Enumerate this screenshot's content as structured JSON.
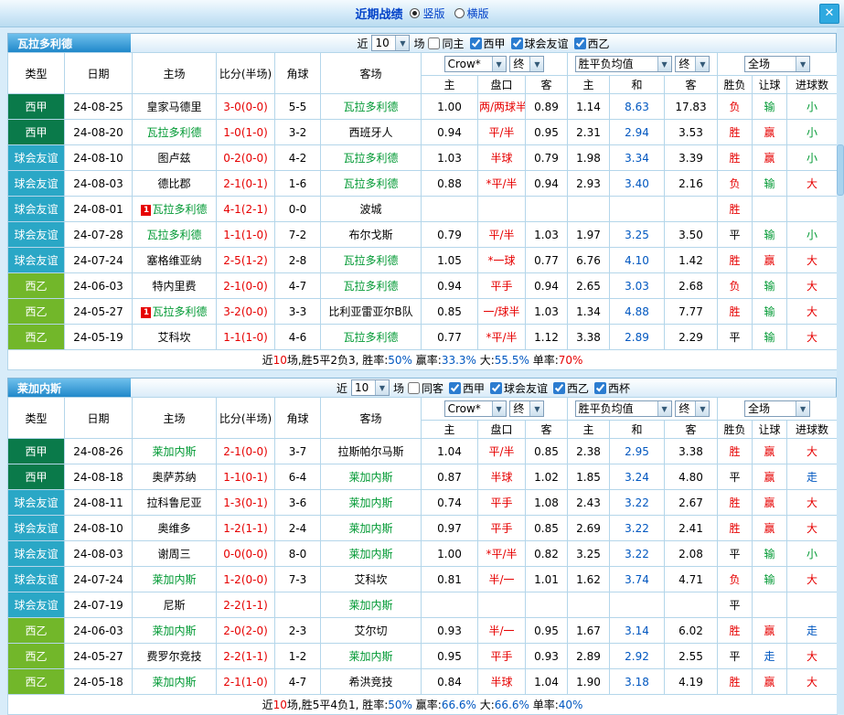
{
  "topbar": {
    "title": "近期战绩",
    "radios": [
      {
        "label": "竖版",
        "selected": true
      },
      {
        "label": "横版",
        "selected": false
      }
    ],
    "close_icon": "✕"
  },
  "table_headers": {
    "left": [
      "类型",
      "日期",
      "主场",
      "比分(半场)",
      "角球",
      "客场"
    ],
    "sub": [
      "主",
      "盘口",
      "客",
      "主",
      "和",
      "客",
      "胜负",
      "让球",
      "进球数"
    ]
  },
  "colors": {
    "accent_blue": "#0141c8",
    "value_blue": "#0057c0",
    "focal_green": "#009933",
    "score_red": "#e60000",
    "league_liga": "#0a7a4a",
    "league_friendly": "#2aa7c6",
    "league_segunda": "#72b72a"
  },
  "sections": [
    {
      "team": "瓦拉多利德",
      "filters": {
        "near": "近",
        "count": "10",
        "suffix": "场",
        "checkboxes": [
          {
            "label": "同主",
            "checked": false
          },
          {
            "label": "西甲",
            "checked": true
          },
          {
            "label": "球会友谊",
            "checked": true
          },
          {
            "label": "西乙",
            "checked": true
          }
        ]
      },
      "selects": {
        "company": "Crow*",
        "company_time": "终",
        "avg": "胜平负均值",
        "avg_time": "终",
        "scope": "全场"
      },
      "rows": [
        {
          "lg": "西甲",
          "lgc": "liga",
          "date": "24-08-25",
          "home": "皇家马德里",
          "hf": false,
          "hb": "",
          "score": "3-0(0-0)",
          "corner": "5-5",
          "away": "瓦拉多利德",
          "af": true,
          "ab": "",
          "oh": "1.00",
          "hc": "两/两球半",
          "oa": "0.89",
          "ah": "1.14",
          "ad": "8.63",
          "aa": "17.83",
          "res": "负",
          "resc": "red",
          "cov": "输",
          "covc": "green",
          "gl": "小",
          "glc": "green"
        },
        {
          "lg": "西甲",
          "lgc": "liga",
          "date": "24-08-20",
          "home": "瓦拉多利德",
          "hf": true,
          "hb": "",
          "score": "1-0(1-0)",
          "corner": "3-2",
          "away": "西班牙人",
          "af": false,
          "ab": "",
          "oh": "0.94",
          "hc": "平/半",
          "oa": "0.95",
          "ah": "2.31",
          "ad": "2.94",
          "aa": "3.53",
          "res": "胜",
          "resc": "red",
          "cov": "赢",
          "covc": "red",
          "gl": "小",
          "glc": "green"
        },
        {
          "lg": "球会友谊",
          "lgc": "friendly",
          "date": "24-08-10",
          "home": "图卢兹",
          "hf": false,
          "hb": "",
          "score": "0-2(0-0)",
          "corner": "4-2",
          "away": "瓦拉多利德",
          "af": true,
          "ab": "",
          "oh": "1.03",
          "hc": "半球",
          "oa": "0.79",
          "ah": "1.98",
          "ad": "3.34",
          "aa": "3.39",
          "res": "胜",
          "resc": "red",
          "cov": "赢",
          "covc": "red",
          "gl": "小",
          "glc": "green"
        },
        {
          "lg": "球会友谊",
          "lgc": "friendly",
          "date": "24-08-03",
          "home": "德比郡",
          "hf": false,
          "hb": "",
          "score": "2-1(0-1)",
          "corner": "1-6",
          "away": "瓦拉多利德",
          "af": true,
          "ab": "",
          "oh": "0.88",
          "hc": "*平/半",
          "oa": "0.94",
          "ah": "2.93",
          "ad": "3.40",
          "aa": "2.16",
          "res": "负",
          "resc": "red",
          "cov": "输",
          "covc": "green",
          "gl": "大",
          "glc": "red"
        },
        {
          "lg": "球会友谊",
          "lgc": "friendly",
          "date": "24-08-01",
          "home": "瓦拉多利德",
          "hf": true,
          "hb": "1",
          "score": "4-1(2-1)",
          "corner": "0-0",
          "away": "波城",
          "af": false,
          "ab": "",
          "oh": "",
          "hc": "",
          "oa": "",
          "ah": "",
          "ad": "",
          "aa": "",
          "res": "胜",
          "resc": "red",
          "cov": "",
          "covc": "",
          "gl": "",
          "glc": ""
        },
        {
          "lg": "球会友谊",
          "lgc": "friendly",
          "date": "24-07-28",
          "home": "瓦拉多利德",
          "hf": true,
          "hb": "",
          "score": "1-1(1-0)",
          "corner": "7-2",
          "away": "布尔戈斯",
          "af": false,
          "ab": "",
          "oh": "0.79",
          "hc": "平/半",
          "oa": "1.03",
          "ah": "1.97",
          "ad": "3.25",
          "aa": "3.50",
          "res": "平",
          "resc": "black",
          "cov": "输",
          "covc": "green",
          "gl": "小",
          "glc": "green"
        },
        {
          "lg": "球会友谊",
          "lgc": "friendly",
          "date": "24-07-24",
          "home": "塞格维亚纳",
          "hf": false,
          "hb": "",
          "score": "2-5(1-2)",
          "corner": "2-8",
          "away": "瓦拉多利德",
          "af": true,
          "ab": "",
          "oh": "1.05",
          "hc": "*一球",
          "oa": "0.77",
          "ah": "6.76",
          "ad": "4.10",
          "aa": "1.42",
          "res": "胜",
          "resc": "red",
          "cov": "赢",
          "covc": "red",
          "gl": "大",
          "glc": "red"
        },
        {
          "lg": "西乙",
          "lgc": "segunda",
          "date": "24-06-03",
          "home": "特内里费",
          "hf": false,
          "hb": "",
          "score": "2-1(0-0)",
          "corner": "4-7",
          "away": "瓦拉多利德",
          "af": true,
          "ab": "",
          "oh": "0.94",
          "hc": "平手",
          "oa": "0.94",
          "ah": "2.65",
          "ad": "3.03",
          "aa": "2.68",
          "res": "负",
          "resc": "red",
          "cov": "输",
          "covc": "green",
          "gl": "大",
          "glc": "red"
        },
        {
          "lg": "西乙",
          "lgc": "segunda",
          "date": "24-05-27",
          "home": "瓦拉多利德",
          "hf": true,
          "hb": "1",
          "score": "3-2(0-0)",
          "corner": "3-3",
          "away": "比利亚雷亚尔B队",
          "af": false,
          "ab": "",
          "oh": "0.85",
          "hc": "一/球半",
          "oa": "1.03",
          "ah": "1.34",
          "ad": "4.88",
          "aa": "7.77",
          "res": "胜",
          "resc": "red",
          "cov": "输",
          "covc": "green",
          "gl": "大",
          "glc": "red"
        },
        {
          "lg": "西乙",
          "lgc": "segunda",
          "date": "24-05-19",
          "home": "艾科坎",
          "hf": false,
          "hb": "",
          "score": "1-1(1-0)",
          "corner": "4-6",
          "away": "瓦拉多利德",
          "af": true,
          "ab": "",
          "oh": "0.77",
          "hc": "*平/半",
          "oa": "1.12",
          "ah": "3.38",
          "ad": "2.89",
          "aa": "2.29",
          "res": "平",
          "resc": "black",
          "cov": "输",
          "covc": "green",
          "gl": "大",
          "glc": "red"
        }
      ],
      "summary": [
        {
          "t": "近"
        },
        {
          "t": "10",
          "c": "red"
        },
        {
          "t": "场,胜5平2负3, 胜率:"
        },
        {
          "t": "50%",
          "c": "blue"
        },
        {
          "t": " 赢率:"
        },
        {
          "t": "33.3%",
          "c": "blue"
        },
        {
          "t": " 大:"
        },
        {
          "t": "55.5%",
          "c": "blue"
        },
        {
          "t": " 单率:"
        },
        {
          "t": "70%",
          "c": "red"
        }
      ]
    },
    {
      "team": "莱加内斯",
      "filters": {
        "near": "近",
        "count": "10",
        "suffix": "场",
        "checkboxes": [
          {
            "label": "同客",
            "checked": false
          },
          {
            "label": "西甲",
            "checked": true
          },
          {
            "label": "球会友谊",
            "checked": true
          },
          {
            "label": "西乙",
            "checked": true
          },
          {
            "label": "西杯",
            "checked": true
          }
        ]
      },
      "selects": {
        "company": "Crow*",
        "company_time": "终",
        "avg": "胜平负均值",
        "avg_time": "终",
        "scope": "全场"
      },
      "rows": [
        {
          "lg": "西甲",
          "lgc": "liga",
          "date": "24-08-26",
          "home": "莱加内斯",
          "hf": true,
          "hb": "",
          "score": "2-1(0-0)",
          "corner": "3-7",
          "away": "拉斯帕尔马斯",
          "af": false,
          "ab": "",
          "oh": "1.04",
          "hc": "平/半",
          "oa": "0.85",
          "ah": "2.38",
          "ad": "2.95",
          "aa": "3.38",
          "res": "胜",
          "resc": "red",
          "cov": "赢",
          "covc": "red",
          "gl": "大",
          "glc": "red"
        },
        {
          "lg": "西甲",
          "lgc": "liga",
          "date": "24-08-18",
          "home": "奥萨苏纳",
          "hf": false,
          "hb": "",
          "score": "1-1(0-1)",
          "corner": "6-4",
          "away": "莱加内斯",
          "af": true,
          "ab": "",
          "oh": "0.87",
          "hc": "半球",
          "oa": "1.02",
          "ah": "1.85",
          "ad": "3.24",
          "aa": "4.80",
          "res": "平",
          "resc": "black",
          "cov": "赢",
          "covc": "red",
          "gl": "走",
          "glc": "blue"
        },
        {
          "lg": "球会友谊",
          "lgc": "friendly",
          "date": "24-08-11",
          "home": "拉科鲁尼亚",
          "hf": false,
          "hb": "",
          "score": "1-3(0-1)",
          "corner": "3-6",
          "away": "莱加内斯",
          "af": true,
          "ab": "",
          "oh": "0.74",
          "hc": "平手",
          "oa": "1.08",
          "ah": "2.43",
          "ad": "3.22",
          "aa": "2.67",
          "res": "胜",
          "resc": "red",
          "cov": "赢",
          "covc": "red",
          "gl": "大",
          "glc": "red"
        },
        {
          "lg": "球会友谊",
          "lgc": "friendly",
          "date": "24-08-10",
          "home": "奥维多",
          "hf": false,
          "hb": "",
          "score": "1-2(1-1)",
          "corner": "2-4",
          "away": "莱加内斯",
          "af": true,
          "ab": "",
          "oh": "0.97",
          "hc": "平手",
          "oa": "0.85",
          "ah": "2.69",
          "ad": "3.22",
          "aa": "2.41",
          "res": "胜",
          "resc": "red",
          "cov": "赢",
          "covc": "red",
          "gl": "大",
          "glc": "red"
        },
        {
          "lg": "球会友谊",
          "lgc": "friendly",
          "date": "24-08-03",
          "home": "谢周三",
          "hf": false,
          "hb": "",
          "score": "0-0(0-0)",
          "corner": "8-0",
          "away": "莱加内斯",
          "af": true,
          "ab": "",
          "oh": "1.00",
          "hc": "*平/半",
          "oa": "0.82",
          "ah": "3.25",
          "ad": "3.22",
          "aa": "2.08",
          "res": "平",
          "resc": "black",
          "cov": "输",
          "covc": "green",
          "gl": "小",
          "glc": "green"
        },
        {
          "lg": "球会友谊",
          "lgc": "friendly",
          "date": "24-07-24",
          "home": "莱加内斯",
          "hf": true,
          "hb": "",
          "score": "1-2(0-0)",
          "corner": "7-3",
          "away": "艾科坎",
          "af": false,
          "ab": "",
          "oh": "0.81",
          "hc": "半/一",
          "oa": "1.01",
          "ah": "1.62",
          "ad": "3.74",
          "aa": "4.71",
          "res": "负",
          "resc": "red",
          "cov": "输",
          "covc": "green",
          "gl": "大",
          "glc": "red"
        },
        {
          "lg": "球会友谊",
          "lgc": "friendly",
          "date": "24-07-19",
          "home": "尼斯",
          "hf": false,
          "hb": "",
          "score": "2-2(1-1)",
          "corner": "",
          "away": "莱加内斯",
          "af": true,
          "ab": "",
          "oh": "",
          "hc": "",
          "oa": "",
          "ah": "",
          "ad": "",
          "aa": "",
          "res": "平",
          "resc": "black",
          "cov": "",
          "covc": "",
          "gl": "",
          "glc": ""
        },
        {
          "lg": "西乙",
          "lgc": "segunda",
          "date": "24-06-03",
          "home": "莱加内斯",
          "hf": true,
          "hb": "",
          "score": "2-0(2-0)",
          "corner": "2-3",
          "away": "艾尔切",
          "af": false,
          "ab": "",
          "oh": "0.93",
          "hc": "半/一",
          "oa": "0.95",
          "ah": "1.67",
          "ad": "3.14",
          "aa": "6.02",
          "res": "胜",
          "resc": "red",
          "cov": "赢",
          "covc": "red",
          "gl": "走",
          "glc": "blue"
        },
        {
          "lg": "西乙",
          "lgc": "segunda",
          "date": "24-05-27",
          "home": "费罗尔竞技",
          "hf": false,
          "hb": "",
          "score": "2-2(1-1)",
          "corner": "1-2",
          "away": "莱加内斯",
          "af": true,
          "ab": "",
          "oh": "0.95",
          "hc": "平手",
          "oa": "0.93",
          "ah": "2.89",
          "ad": "2.92",
          "aa": "2.55",
          "res": "平",
          "resc": "black",
          "cov": "走",
          "covc": "blue",
          "gl": "大",
          "glc": "red"
        },
        {
          "lg": "西乙",
          "lgc": "segunda",
          "date": "24-05-18",
          "home": "莱加内斯",
          "hf": true,
          "hb": "",
          "score": "2-1(1-0)",
          "corner": "4-7",
          "away": "希洪竞技",
          "af": false,
          "ab": "",
          "oh": "0.84",
          "hc": "半球",
          "oa": "1.04",
          "ah": "1.90",
          "ad": "3.18",
          "aa": "4.19",
          "res": "胜",
          "resc": "red",
          "cov": "赢",
          "covc": "red",
          "gl": "大",
          "glc": "red"
        }
      ],
      "summary": [
        {
          "t": "近"
        },
        {
          "t": "10",
          "c": "red"
        },
        {
          "t": "场,胜5平4负1, 胜率:"
        },
        {
          "t": "50%",
          "c": "blue"
        },
        {
          "t": " 赢率:"
        },
        {
          "t": "66.6%",
          "c": "blue"
        },
        {
          "t": " 大:"
        },
        {
          "t": "66.6%",
          "c": "blue"
        },
        {
          "t": " 单率:"
        },
        {
          "t": "40%",
          "c": "blue"
        }
      ]
    }
  ]
}
